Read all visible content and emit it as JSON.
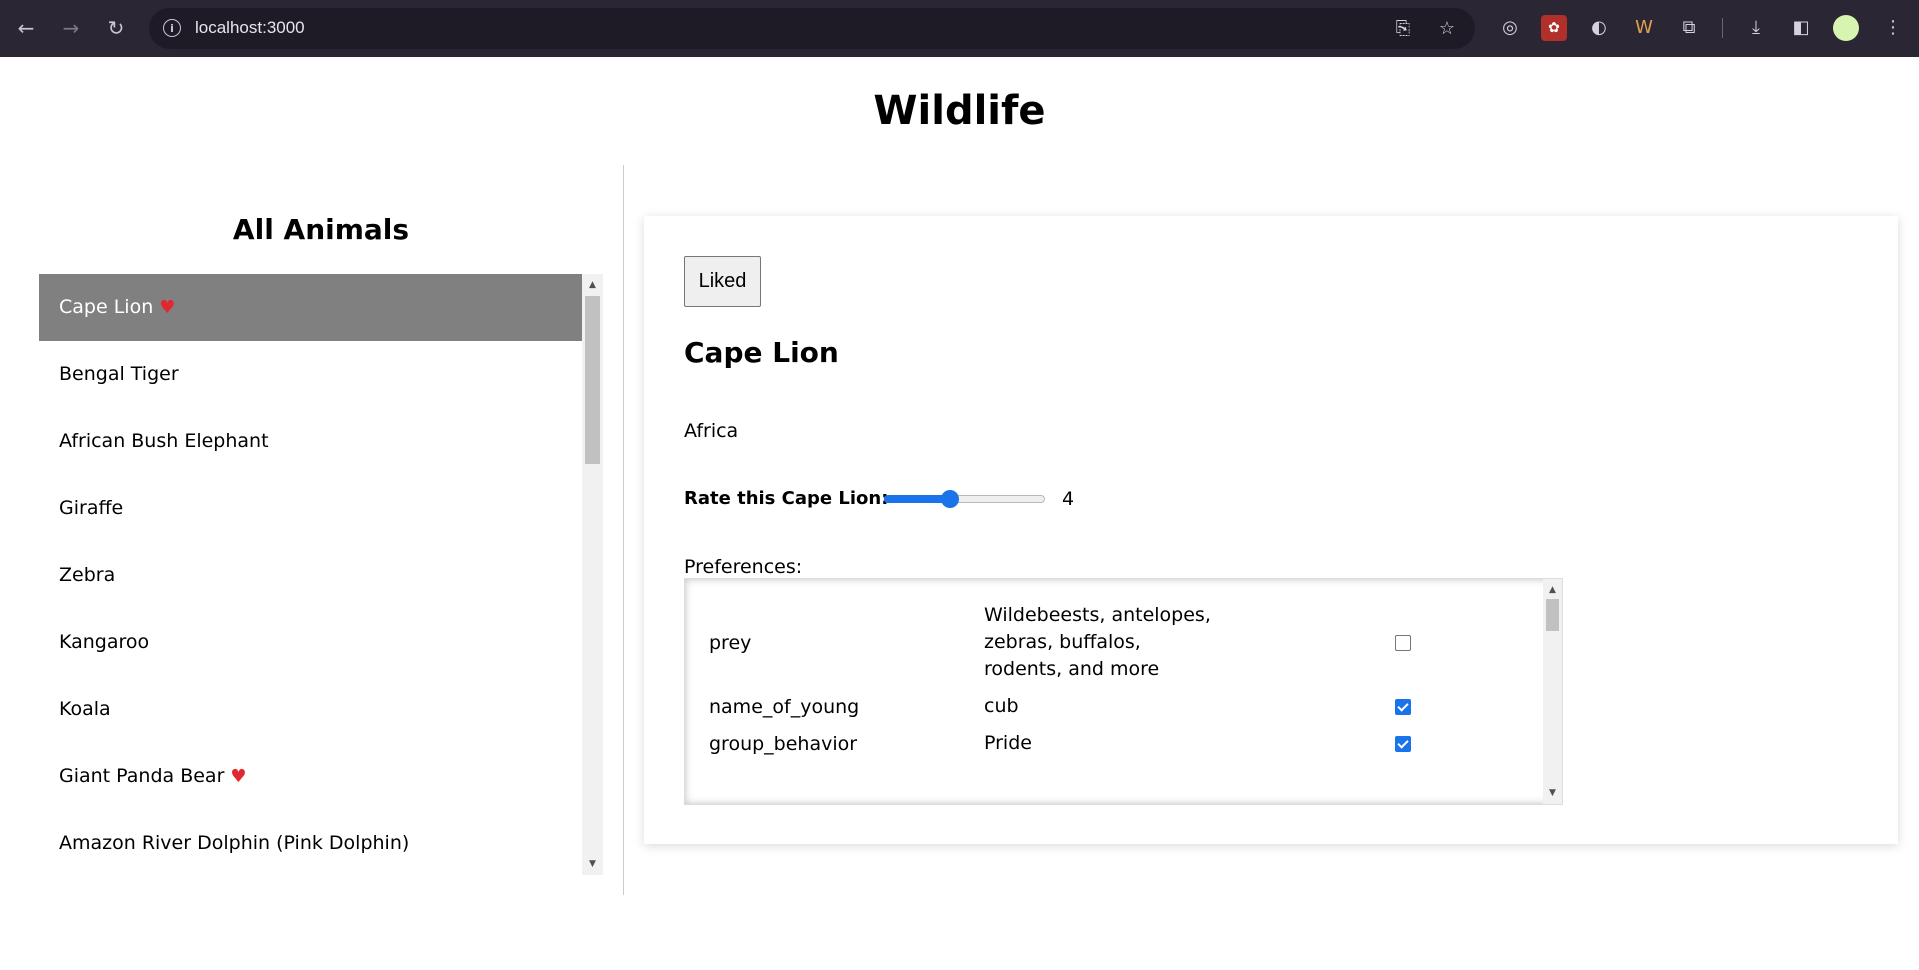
{
  "browser": {
    "url": "localhost:3000"
  },
  "page": {
    "title": "Wildlife"
  },
  "sidebar": {
    "heading": "All Animals",
    "items": [
      {
        "label": "Cape Lion",
        "liked": true,
        "selected": true
      },
      {
        "label": "Bengal Tiger",
        "liked": false,
        "selected": false
      },
      {
        "label": "African Bush Elephant",
        "liked": false,
        "selected": false
      },
      {
        "label": "Giraffe",
        "liked": false,
        "selected": false
      },
      {
        "label": "Zebra",
        "liked": false,
        "selected": false
      },
      {
        "label": "Kangaroo",
        "liked": false,
        "selected": false
      },
      {
        "label": "Koala",
        "liked": false,
        "selected": false
      },
      {
        "label": "Giant Panda Bear",
        "liked": true,
        "selected": false
      },
      {
        "label": "Amazon River Dolphin (Pink Dolphin)",
        "liked": false,
        "selected": false
      }
    ]
  },
  "detail": {
    "liked_button": "Liked",
    "name": "Cape Lion",
    "region": "Africa",
    "rate_label": "Rate this Cape Lion:",
    "rating": {
      "value": 4,
      "min": 0,
      "max": 10
    },
    "preferences_label": "Preferences:",
    "preferences": [
      {
        "key": "prey",
        "value": "Wildebeests, antelopes, zebras, buffalos, rodents, and more",
        "checked": false
      },
      {
        "key": "name_of_young",
        "value": "cub",
        "checked": true
      },
      {
        "key": "group_behavior",
        "value": "Pride",
        "checked": true
      }
    ]
  },
  "colors": {
    "accent": "#1a73e8",
    "selected_bg": "#808080",
    "heart": "#e0282e",
    "chrome_bg": "#2b2634"
  }
}
